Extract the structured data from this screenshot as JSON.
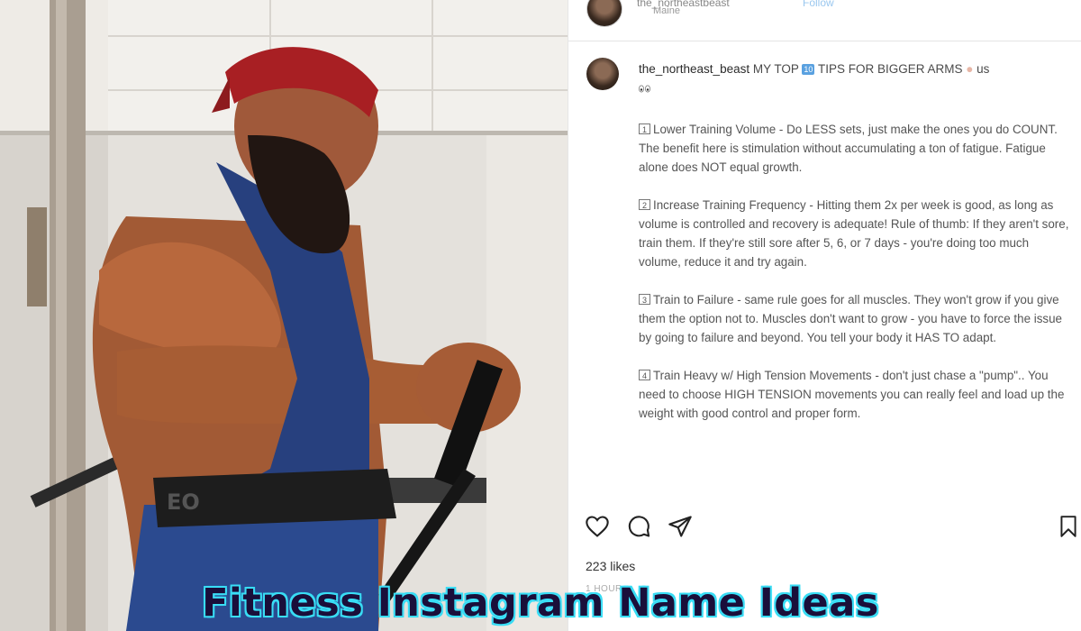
{
  "post_header": {
    "username": "the_northeastbeast",
    "follow_label": "Follow",
    "subtitle": "Maine",
    "more_icon": "more-icon"
  },
  "caption": {
    "username": "the_northeast_beast",
    "text_before": "MY TOP",
    "number_emoji": "10",
    "text_after": "TIPS FOR BIGGER ARMS",
    "trailing": "us"
  },
  "tips": [
    {
      "num": "1",
      "text": "Lower Training Volume - Do LESS sets, just make the ones you do COUNT. The benefit here is stimulation without accumulating a ton of fatigue. Fatigue alone does NOT equal growth."
    },
    {
      "num": "2",
      "text": "Increase Training Frequency - Hitting them 2x per week is good, as long as volume is controlled and recovery is adequate! Rule of thumb: If they aren't sore, train them. If they're still sore after 5, 6, or 7 days - you're doing too much volume, reduce it and try again."
    },
    {
      "num": "3",
      "text": "Train to Failure - same rule goes for all muscles. They won't grow if you give them the option not to. Muscles don't want to grow - you have to force the issue by going to failure and beyond. You tell your body it HAS TO adapt."
    },
    {
      "num": "4",
      "text": "Train Heavy w/ High Tension Movements - don't just chase a \"pump\".. You need to choose HIGH TENSION movements you can really feel and load up the weight with good control and proper form."
    }
  ],
  "actions": {
    "like_icon": "heart-icon",
    "comment_icon": "comment-icon",
    "share_icon": "send-icon",
    "save_icon": "bookmark-icon"
  },
  "likes": "223 likes",
  "timestamp": "1 HOUR",
  "banner_title": "Fitness Instagram Name Ideas",
  "colors": {
    "banner_text": "#1a0f3a",
    "banner_glow": "#38d9f2",
    "link_blue": "#9ac7ef"
  }
}
